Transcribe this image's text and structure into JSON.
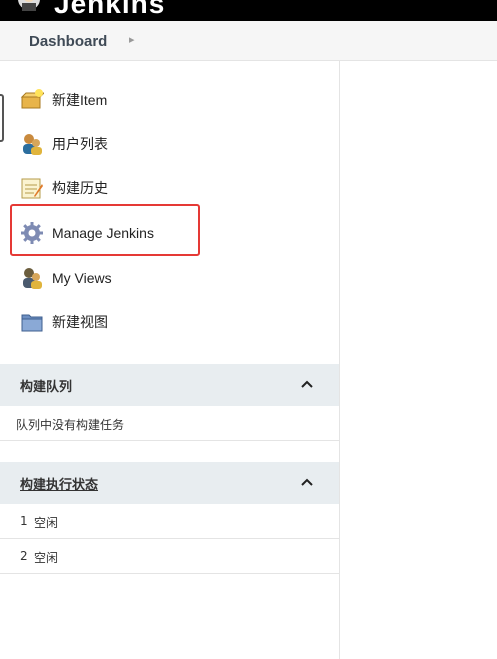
{
  "header": {
    "brand": "Jenkins"
  },
  "breadcrumb": {
    "dashboard": "Dashboard"
  },
  "tasks": [
    {
      "label": "新建Item",
      "icon": "new-item-box-icon"
    },
    {
      "label": "用户列表",
      "icon": "users-icon"
    },
    {
      "label": "构建历史",
      "icon": "notepad-history-icon"
    },
    {
      "label": "Manage Jenkins",
      "icon": "gear-icon"
    },
    {
      "label": "My Views",
      "icon": "users-icon"
    },
    {
      "label": "新建视图",
      "icon": "folder-icon"
    }
  ],
  "build_queue": {
    "title": "构建队列",
    "empty_text": "队列中没有构建任务"
  },
  "executors": {
    "title": "构建执行状态",
    "rows": [
      {
        "num": "1",
        "status": "空闲"
      },
      {
        "num": "2",
        "status": "空闲"
      }
    ]
  },
  "colors": {
    "highlight": "#e53935",
    "pane_header": "#e8edf0"
  }
}
